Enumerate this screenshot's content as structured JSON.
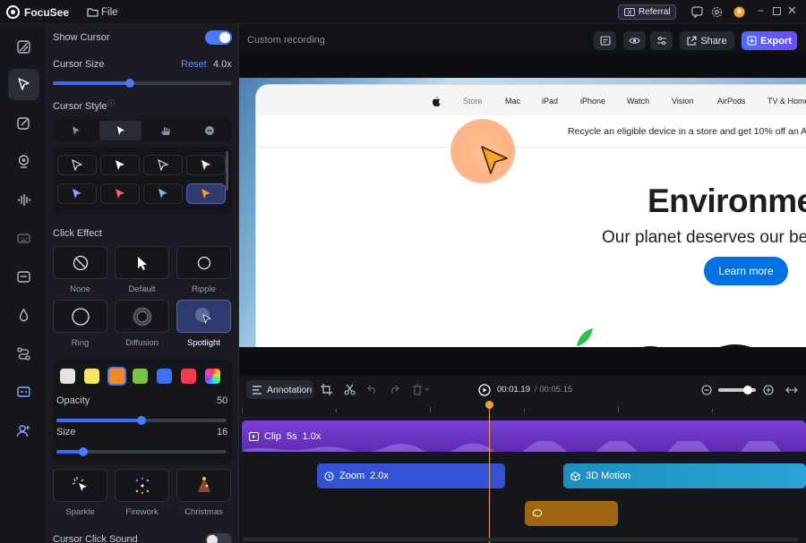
{
  "app": {
    "name": "FocuSee",
    "menu_file": "File",
    "referral": "Referral"
  },
  "rail": [
    "crop-icon",
    "cursor-icon",
    "edit-icon",
    "webcam-icon",
    "audio-icon",
    "keyboard-icon",
    "caption-icon",
    "drop-icon",
    "route-icon",
    "subtitle-icon",
    "user-add-icon"
  ],
  "panel": {
    "show_cursor": "Show Cursor",
    "cursor_size": "Cursor Size",
    "reset": "Reset",
    "size_value": "4.0x",
    "size_level": 0.43,
    "cursor_style": "Cursor Style",
    "click_effect": "Click Effect",
    "effects": [
      "None",
      "Default",
      "Ripple",
      "Ring",
      "Diffusion",
      "Spotlight"
    ],
    "colors": [
      "#e4e4e4",
      "#f5e663",
      "#f08a2e",
      "#7fc24a",
      "#3c74f0",
      "#f03c52",
      "rainbow"
    ],
    "opacity_label": "Opacity",
    "opacity_value": "50",
    "opacity_level": 0.5,
    "size_label": "Size",
    "size2_value": "16",
    "size2_level": 0.16,
    "sound_effects": [
      "Sparkle",
      "Firework",
      "Christmas"
    ],
    "cursor_click_sound": "Cursor Click Sound"
  },
  "toolbar": {
    "title": "Custom recording",
    "share": "Share",
    "export": "Export"
  },
  "preview": {
    "nav": [
      "Store",
      "Mac",
      "iPad",
      "iPhone",
      "Watch",
      "Vision",
      "AirPods",
      "TV & Home"
    ],
    "banner": "Recycle an eligible device in a store and get 10% off an Ap",
    "headline": "Environme",
    "subhead": "Our planet deserves our be",
    "cta": "Learn more"
  },
  "timeline": {
    "annotation": "Annotation",
    "time_current": "00:01.19",
    "time_total": "/ 00:05.15",
    "clip_label": "Clip",
    "clip_duration": "5s",
    "clip_speed": "1.0x",
    "zoom_label": "Zoom",
    "zoom_value": "2.0x",
    "motion_label": "3D Motion"
  }
}
